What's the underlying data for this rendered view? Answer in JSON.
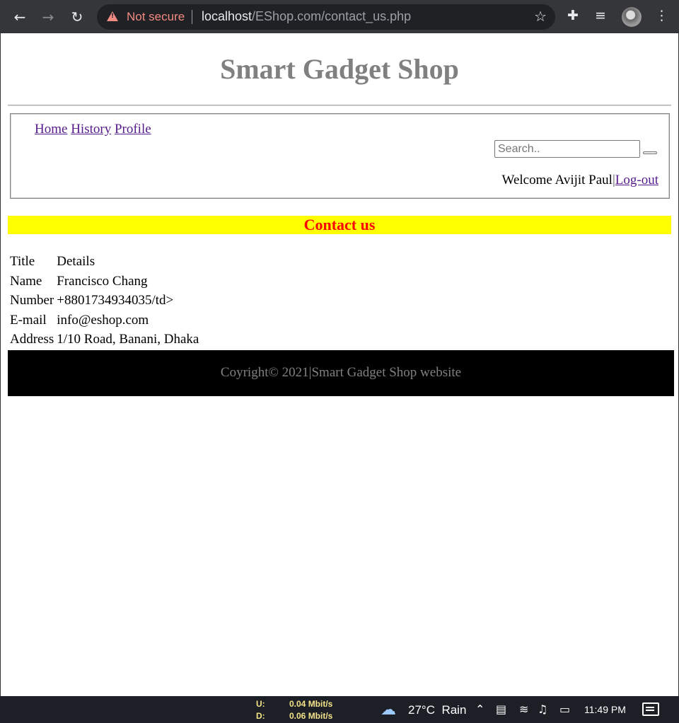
{
  "browser": {
    "security_label": "Not secure",
    "url_host": "localhost",
    "url_path": "/EShop.com/contact_us.php"
  },
  "header": {
    "title": "Smart Gadget Shop"
  },
  "nav": {
    "links": [
      "Home",
      "History",
      "Profile"
    ],
    "search_placeholder": "Search..",
    "welcome_text": "Welcome Avijit Paul",
    "separator": "|",
    "logout_label": "Log-out"
  },
  "contact": {
    "heading": "Contact us",
    "rows": [
      {
        "label": "Title",
        "value": "Details"
      },
      {
        "label": "Name",
        "value": "Francisco Chang"
      },
      {
        "label": "Number",
        "value": "+8801734934035/td>"
      },
      {
        "label": "E-mail",
        "value": "info@eshop.com"
      },
      {
        "label": "Address",
        "value": "1/10 Road, Banani, Dhaka"
      }
    ]
  },
  "footer": {
    "text": "Coyright© 2021|Smart Gadget Shop website"
  },
  "taskbar": {
    "upload_label": "U:",
    "download_label": "D:",
    "upload_speed": "0.04 Mbit/s",
    "download_speed": "0.06 Mbit/s",
    "temperature": "27°C",
    "weather": "Rain",
    "time": "11:49 PM"
  },
  "colors": {
    "contact_bar_bg": "#ffff00",
    "contact_heading": "#ff0000",
    "title_gray": "#808080",
    "link_visited": "#551a8b"
  }
}
